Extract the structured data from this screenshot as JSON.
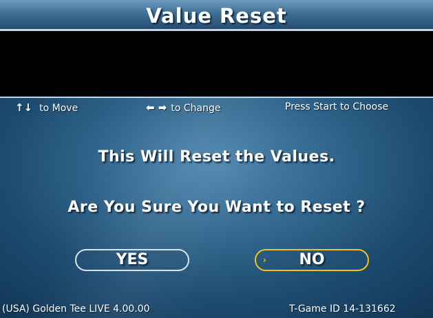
{
  "title": "Value Reset",
  "hints": {
    "move_icon": "up-down-arrows-icon",
    "move_glyph": "↑↓",
    "move_text": "to Move",
    "change_icon": "left-right-arrows-icon",
    "change_glyph": "⬅ ➡",
    "change_text": "to Change",
    "choose_text": "Press Start to Choose"
  },
  "message": {
    "line1": "This Will Reset the Values.",
    "line2": "Are You Sure You Want to Reset ?"
  },
  "buttons": {
    "yes_label": "YES",
    "no_label": "NO",
    "selected": "NO",
    "selection_icon": "right-triangle-icon",
    "selection_glyph": "›"
  },
  "footer": {
    "version": "(USA) Golden Tee LIVE 4.00.00",
    "game_id": "T-Game ID 14-131662"
  },
  "colors": {
    "selected_border": "#f3c21b",
    "unselected_border": "#d9e4ee",
    "background": "#33678e",
    "panel": "#000000"
  }
}
